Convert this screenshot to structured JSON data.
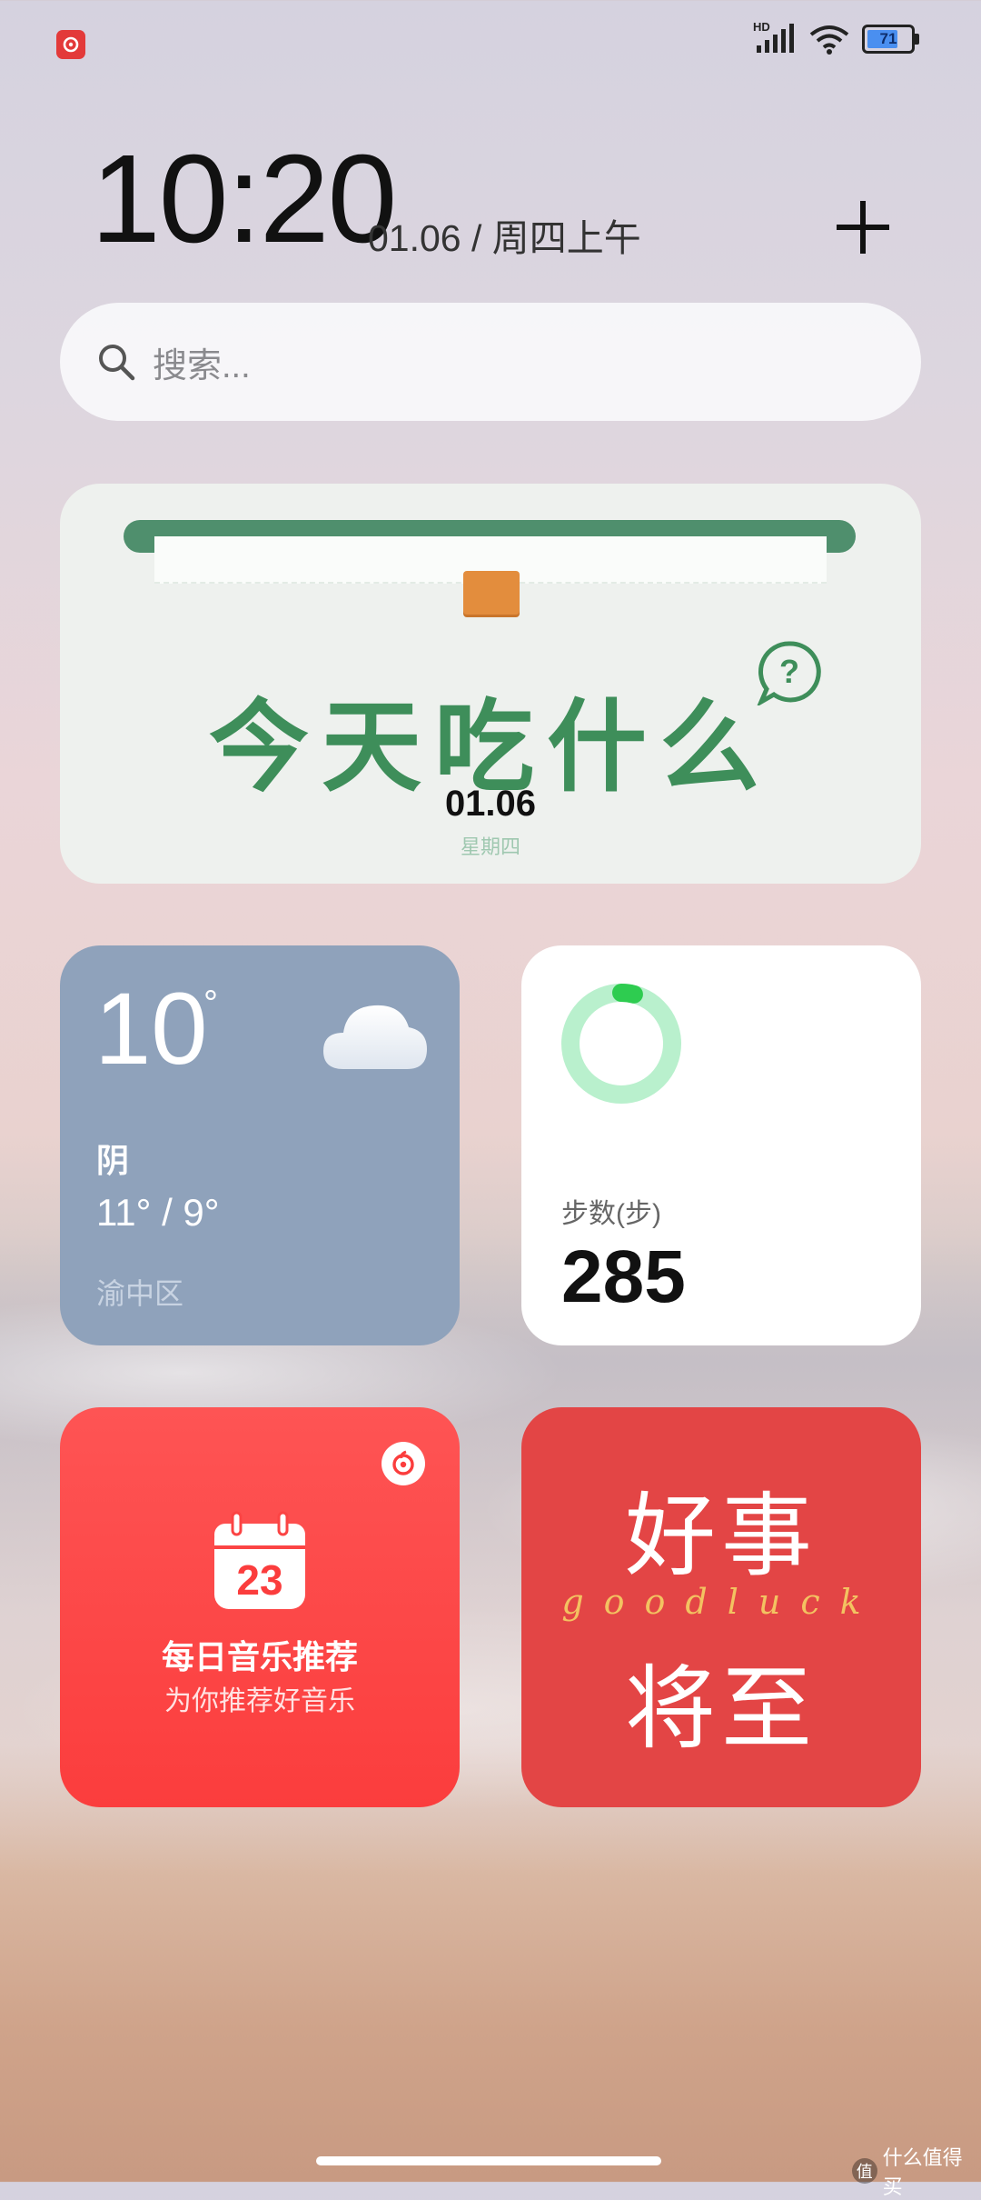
{
  "status_bar": {
    "notification_icon": "netease-music-icon",
    "signal_label": "HD",
    "battery_level": "71"
  },
  "header": {
    "time": "10:20",
    "date": "01.06 / 周四上午",
    "add_icon": "plus-icon"
  },
  "search": {
    "placeholder": "搜索..."
  },
  "food_widget": {
    "title": "今天吃什么",
    "date": "01.06",
    "weekday": "星期四",
    "accent": "#3e8e5a"
  },
  "weather_widget": {
    "temperature": "10",
    "degree": "°",
    "condition": "阴",
    "range": "11° / 9°",
    "location": "渝中区",
    "icon": "cloud-icon"
  },
  "steps_widget": {
    "label": "步数(步)",
    "value": "285",
    "progress": 0.04,
    "ring_color": "#b9f0cd",
    "progress_color": "#2ecc50"
  },
  "music_widget": {
    "calendar_day": "23",
    "title": "每日音乐推荐",
    "subtitle": "为你推荐好音乐"
  },
  "luck_widget": {
    "line1": "好事",
    "english": "goodluck",
    "line2": "将至"
  },
  "watermark": {
    "badge": "值",
    "text": "什么值得买"
  }
}
